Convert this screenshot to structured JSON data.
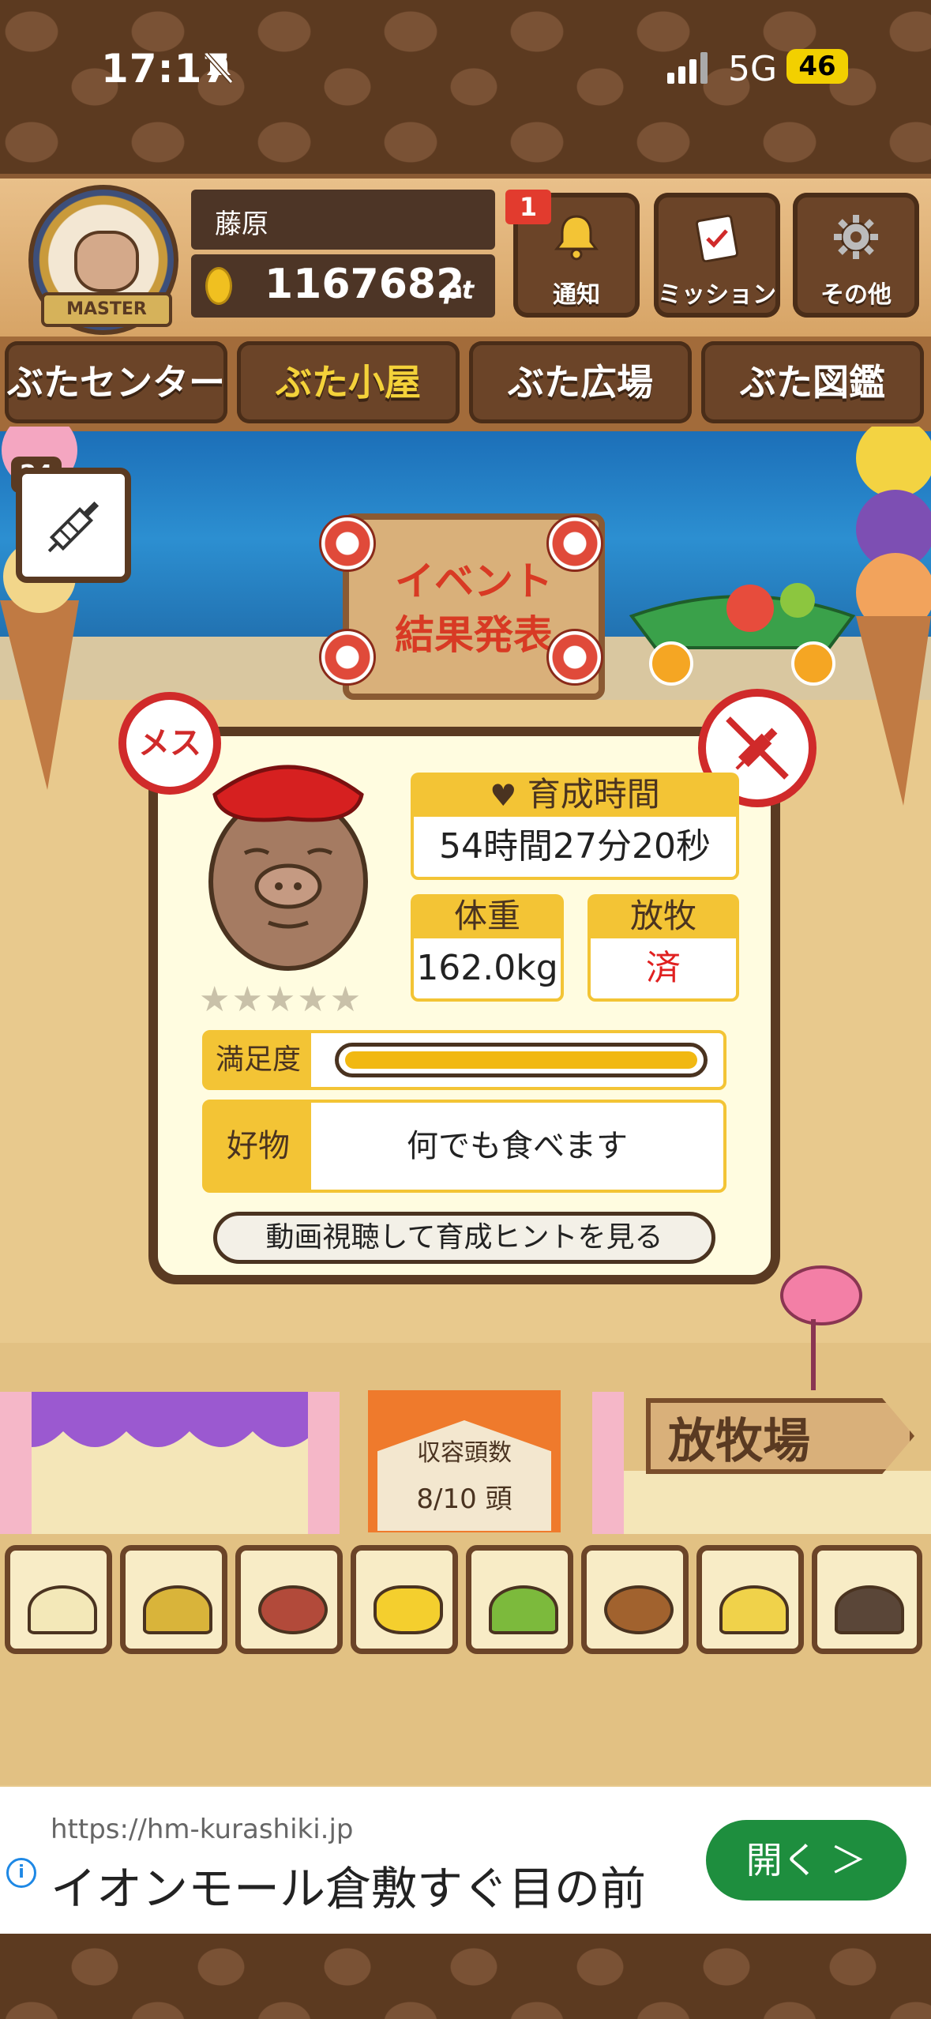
{
  "status": {
    "time": "17:17",
    "network": "5G",
    "battery": "46"
  },
  "header": {
    "rank_badge": "MASTER",
    "player_name": "藤原",
    "points": "1167682",
    "points_unit": "pt",
    "notify": {
      "label": "通知",
      "count": "1"
    },
    "mission": {
      "label": "ミッション"
    },
    "other": {
      "label": "その他"
    }
  },
  "nav": {
    "tabs": [
      "ぶたセンター",
      "ぶた小屋",
      "ぶた広場",
      "ぶた図鑑"
    ],
    "active_index": 1
  },
  "scene": {
    "syringe_count": "24",
    "event_sign": [
      "イベント",
      "結果発表"
    ]
  },
  "pig_card": {
    "gender_label": "メス",
    "rating_stars": "★★★★★",
    "growth_time": {
      "label": "育成時間",
      "value": "54時間27分20秒"
    },
    "weight": {
      "label": "体重",
      "value": "162.0kg"
    },
    "grazing": {
      "label": "放牧",
      "value": "済"
    },
    "satisfaction": {
      "label": "満足度",
      "level": 1.0
    },
    "favorite": {
      "label": "好物",
      "value": "何でも食べます"
    },
    "hint_button": "動画視聴して育成ヒントを見る"
  },
  "pen": {
    "capacity_title": "収容頭数",
    "capacity_value": "8/10 頭",
    "ranch_sign": "放牧場"
  },
  "food_items": [
    "grain-icon",
    "mixed-grain-icon",
    "sweet-potato-icon",
    "corn-icon",
    "herb-icon",
    "acorn-icon",
    "soybean-icon",
    "truffle-icon"
  ],
  "ad": {
    "url": "https://hm-kurashiki.jp",
    "title": "イオンモール倉敷すぐ目の前",
    "button": "開く ＞"
  },
  "colors": {
    "accent_yellow": "#f3c435",
    "wood_dark": "#5a3a22",
    "alert_red": "#d02a2a",
    "ad_green": "#1e8e3e"
  }
}
